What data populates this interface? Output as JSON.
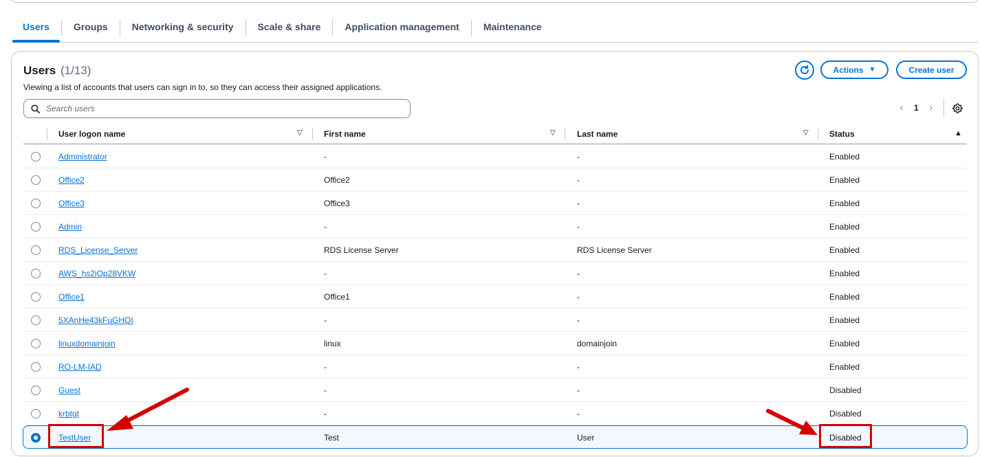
{
  "tabs": [
    {
      "label": "Users",
      "active": true
    },
    {
      "label": "Groups",
      "active": false
    },
    {
      "label": "Networking & security",
      "active": false
    },
    {
      "label": "Scale & share",
      "active": false
    },
    {
      "label": "Application management",
      "active": false
    },
    {
      "label": "Maintenance",
      "active": false
    }
  ],
  "panel": {
    "title": "Users",
    "count": "(1/13)",
    "description": "Viewing a list of accounts that users can sign in to, so they can access their assigned applications.",
    "refresh_icon": "refresh-icon",
    "actions_label": "Actions",
    "create_label": "Create user"
  },
  "search": {
    "placeholder": "Search users",
    "value": ""
  },
  "pagination": {
    "prev": "‹",
    "page": "1",
    "next": "›",
    "settings_icon": "gear-icon"
  },
  "table": {
    "columns": [
      "User logon name",
      "First name",
      "Last name",
      "Status"
    ],
    "rows": [
      {
        "logon": "Administrator",
        "first": "-",
        "last": "-",
        "status": "Enabled",
        "selected": false
      },
      {
        "logon": "Office2",
        "first": "Office2",
        "last": "-",
        "status": "Enabled",
        "selected": false
      },
      {
        "logon": "Office3",
        "first": "Office3",
        "last": "-",
        "status": "Enabled",
        "selected": false
      },
      {
        "logon": "Admin",
        "first": "-",
        "last": "-",
        "status": "Enabled",
        "selected": false
      },
      {
        "logon": "RDS_License_Server",
        "first": "RDS License Server",
        "last": "RDS License Server",
        "status": "Enabled",
        "selected": false
      },
      {
        "logon": "AWS_hs2iOp28VKW",
        "first": "-",
        "last": "-",
        "status": "Enabled",
        "selected": false
      },
      {
        "logon": "Office1",
        "first": "Office1",
        "last": "-",
        "status": "Enabled",
        "selected": false
      },
      {
        "logon": "5XAnHe43kFuGHQI",
        "first": "-",
        "last": "-",
        "status": "Enabled",
        "selected": false
      },
      {
        "logon": "linuxdomainjoin",
        "first": "linux",
        "last": "domainjoin",
        "status": "Enabled",
        "selected": false
      },
      {
        "logon": "RO-LM-IAD",
        "first": "-",
        "last": "-",
        "status": "Enabled",
        "selected": false
      },
      {
        "logon": "Guest",
        "first": "-",
        "last": "-",
        "status": "Disabled",
        "selected": false
      },
      {
        "logon": "krbtgt",
        "first": "-",
        "last": "-",
        "status": "Disabled",
        "selected": false
      },
      {
        "logon": "TestUser",
        "first": "Test",
        "last": "User",
        "status": "Disabled",
        "selected": true
      }
    ]
  },
  "colors": {
    "accent": "#0972d3",
    "annotation": "#d40000",
    "selected_bg": "#f2f8fd"
  }
}
